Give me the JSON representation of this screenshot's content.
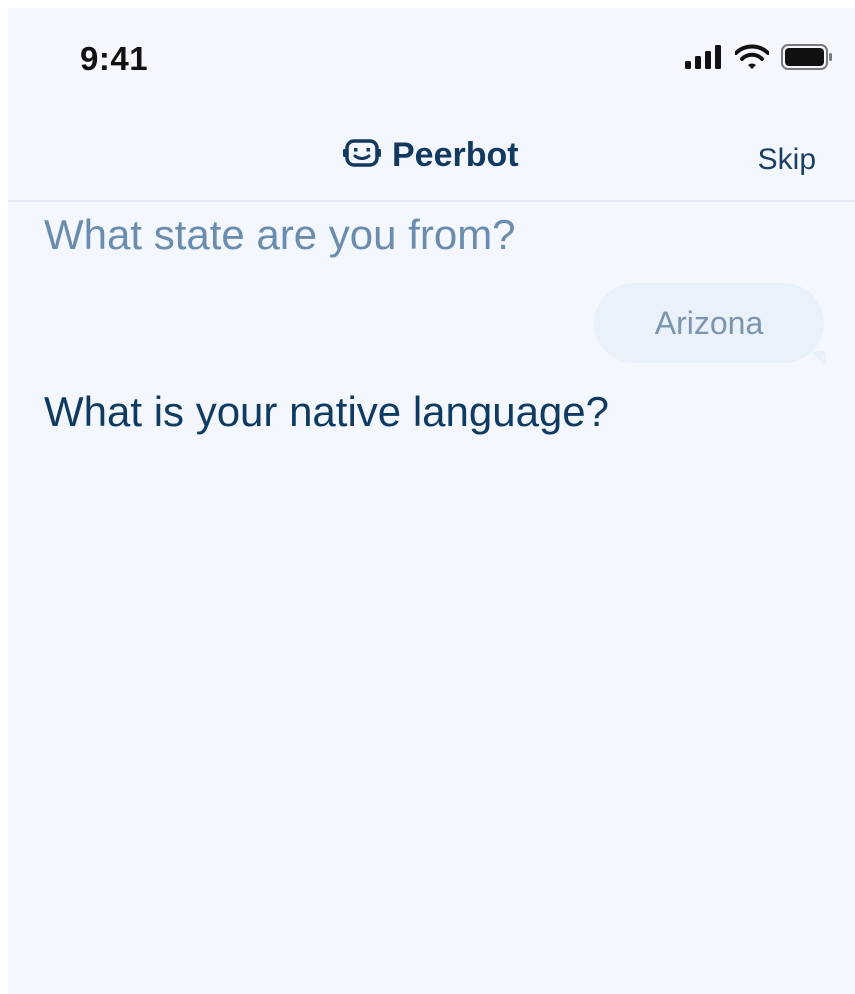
{
  "status_bar": {
    "time": "9:41",
    "icons": [
      "cellular-signal-icon",
      "wifi-icon",
      "battery-icon"
    ]
  },
  "header": {
    "brand_icon": "robot-face-icon",
    "title": "Peerbot",
    "skip_label": "Skip"
  },
  "chat": {
    "previous_question": "What state are you from?",
    "previous_answer": "Arizona",
    "current_question": "What is your native language?"
  },
  "colors": {
    "background": "#F4F8FE",
    "brand": "#12395F",
    "faded_question": "#6A8CAE",
    "answer_bubble": "#E9F1FB",
    "answer_text": "#7D94AD",
    "active_question": "#0F3A62"
  }
}
